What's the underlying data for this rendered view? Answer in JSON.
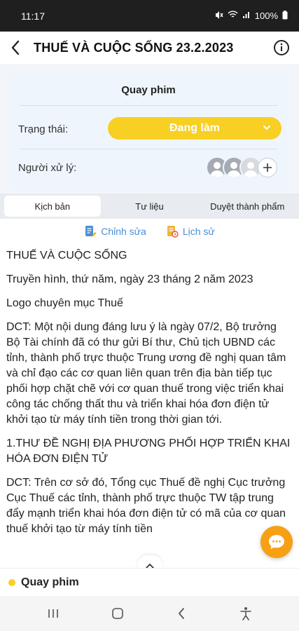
{
  "status_bar": {
    "time": "11:17",
    "battery": "100%"
  },
  "header": {
    "title": "THUẾ VÀ CUỘC SỐNG 23.2.2023"
  },
  "card": {
    "title": "Quay phim",
    "status_label": "Trạng thái:",
    "status_value": "Đang làm",
    "handler_label": "Người xử lý:"
  },
  "tabs": [
    {
      "label": "Kịch bản",
      "active": true
    },
    {
      "label": "Tư liệu",
      "active": false
    },
    {
      "label": "Duyệt thành phẩm",
      "active": false
    }
  ],
  "actions": {
    "edit": "Chỉnh sửa",
    "history": "Lịch sử"
  },
  "content": {
    "p1": "THUẾ VÀ CUỘC SỐNG",
    "p2": "Truyền hình, thứ năm, ngày 23 tháng 2 năm 2023",
    "p3": "Logo chuyên mục Thuế",
    "p4": "DCT: Một nội dung đáng lưu ý là ngày 07/2, Bộ trưởng Bộ Tài chính đã có thư gửi Bí thư, Chủ tịch UBND các tỉnh, thành phố trực thuộc Trung ương đề nghị quan tâm và chỉ đạo các cơ quan liên quan trên địa bàn tiếp tục phối hợp chặt chẽ với cơ quan thuế trong việc triển khai công tác chống thất thu và triển khai hóa đơn điện tử khởi tạo từ máy tính tiền trong thời gian tới.",
    "p5": "1.THƯ ĐỀ NGHỊ ĐỊA PHƯƠNG PHỐI HỢP TRIỂN KHAI HÓA ĐƠN ĐIỆN TỬ",
    "p6": "DCT: Trên cơ sở đó, Tổng cục Thuế đề nghị Cục trưởng Cục Thuế các tỉnh, thành phố trực thuộc TW tập trung đẩy mạnh triển khai hóa đơn điện tử có mã của cơ quan thuế khởi tạo từ máy tính tiền"
  },
  "bottom": {
    "label": "Quay phim"
  },
  "colors": {
    "accent_yellow": "#f8cf23",
    "link_blue": "#4a8fd6",
    "fab_orange": "#f7a014"
  }
}
